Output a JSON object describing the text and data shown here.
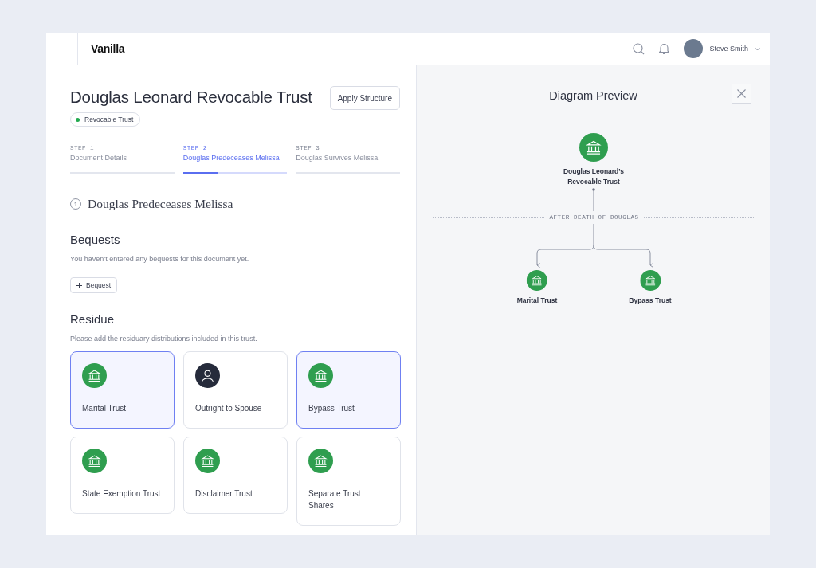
{
  "header": {
    "logo": "Vanilla",
    "user_name": "Steve Smith"
  },
  "document": {
    "title": "Douglas Leonard Revocable Trust",
    "apply_button": "Apply Structure",
    "badge": {
      "label": "Revocable Trust",
      "color": "#22a94f"
    }
  },
  "steps": [
    {
      "number": "STEP 1",
      "label": "Document Details",
      "selected": false
    },
    {
      "number": "STEP 2",
      "label": "Douglas Predeceases Melissa",
      "selected": true,
      "level": 0.33
    },
    {
      "number": "STEP 3",
      "label": "Douglas Survives Melissa",
      "selected": false
    }
  ],
  "scenario": {
    "number": "1",
    "title": "Douglas Predeceases Melissa"
  },
  "bequests": {
    "heading": "Bequests",
    "message": "You haven’t entered any bequests for this document yet.",
    "add_button": "Bequest"
  },
  "residue": {
    "heading": "Residue",
    "message": "Please add the residuary distributions included in this trust.",
    "options": [
      {
        "label": "Marital Trust",
        "kind": "trust",
        "selected": true
      },
      {
        "label": "Outright to Spouse",
        "kind": "person",
        "selected": false
      },
      {
        "label": "Bypass Trust",
        "kind": "trust",
        "selected": true
      },
      {
        "label": "State Exemption Trust",
        "kind": "trust",
        "selected": false
      },
      {
        "label": "Disclaimer Trust",
        "kind": "trust",
        "selected": false
      },
      {
        "label": "Separate Trust Shares",
        "kind": "trust",
        "selected": false
      }
    ]
  },
  "diagram": {
    "title": "Diagram Preview",
    "root": {
      "label": "Douglas Leonard’s Revocable Trust"
    },
    "divider_label": "AFTER DEATH OF DOUGLAS",
    "children": [
      {
        "label": "Marital Trust"
      },
      {
        "label": "Bypass Trust"
      }
    ]
  }
}
